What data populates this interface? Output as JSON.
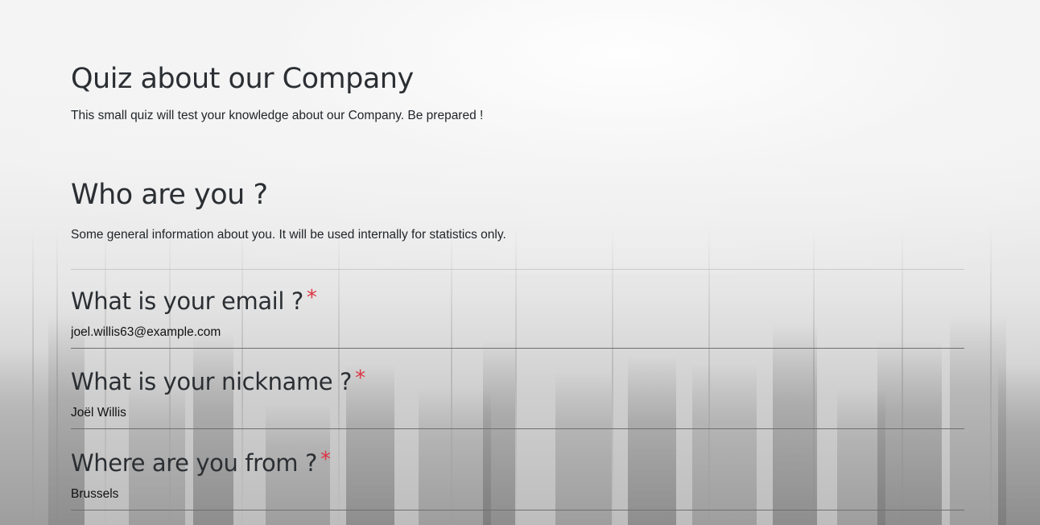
{
  "survey": {
    "title": "Quiz about our Company",
    "description": "This small quiz will test your knowledge about our Company. Be prepared !"
  },
  "section": {
    "title": "Who are you ?",
    "description": "Some general information about you. It will be used internally for statistics only."
  },
  "questions": [
    {
      "label": "What is your email ?",
      "required_mark": "*",
      "value": "joel.willis63@example.com"
    },
    {
      "label": "What is your nickname ?",
      "required_mark": "*",
      "value": "Joël Willis"
    },
    {
      "label": "Where are you from ?",
      "required_mark": "*",
      "value": "Brussels"
    }
  ],
  "colors": {
    "required": "#dc3545",
    "text": "#212529"
  },
  "background": "city-skyline-fog-image"
}
